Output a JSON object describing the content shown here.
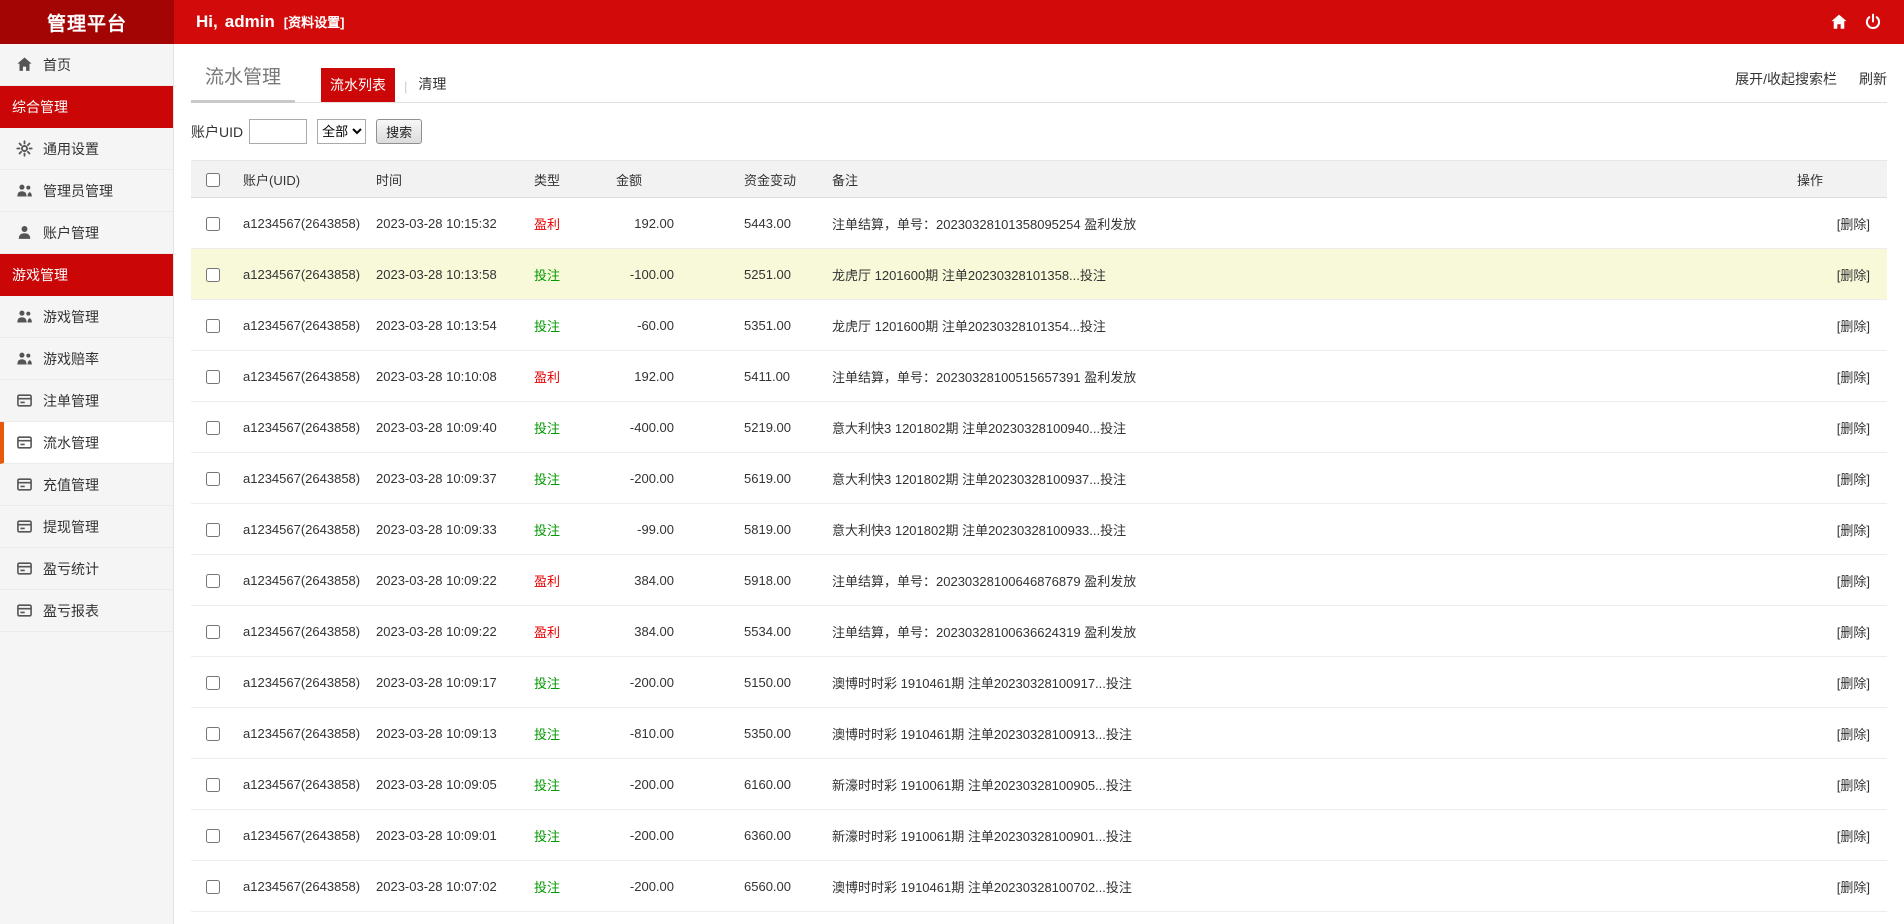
{
  "header": {
    "logo": "管理平台",
    "greeting_prefix": "Hi,",
    "username": "admin",
    "profile_link": "[资料设置]"
  },
  "sidebar": {
    "items": [
      {
        "key": "home",
        "type": "item",
        "label": "首页",
        "icon": "home-icon",
        "active": false
      },
      {
        "key": "section-general",
        "type": "section",
        "label": "综合管理"
      },
      {
        "key": "general-settings",
        "type": "item",
        "label": "通用设置",
        "icon": "gear-icon",
        "active": false
      },
      {
        "key": "admin-management",
        "type": "item",
        "label": "管理员管理",
        "icon": "admins-icon",
        "active": false
      },
      {
        "key": "account-management",
        "type": "item",
        "label": "账户管理",
        "icon": "user-icon",
        "active": false
      },
      {
        "key": "section-games",
        "type": "section",
        "label": "游戏管理"
      },
      {
        "key": "game-management",
        "type": "item",
        "label": "游戏管理",
        "icon": "games-icon",
        "active": false
      },
      {
        "key": "game-odds",
        "type": "item",
        "label": "游戏赔率",
        "icon": "odds-icon",
        "active": false
      },
      {
        "key": "bet-orders",
        "type": "item",
        "label": "注单管理",
        "icon": "orders-icon",
        "active": false
      },
      {
        "key": "flow-management",
        "type": "item",
        "label": "流水管理",
        "icon": "flow-icon",
        "active": true
      },
      {
        "key": "recharge-management",
        "type": "item",
        "label": "充值管理",
        "icon": "recharge-icon",
        "active": false
      },
      {
        "key": "withdraw-management",
        "type": "item",
        "label": "提现管理",
        "icon": "withdraw-icon",
        "active": false
      },
      {
        "key": "pnl-stats",
        "type": "item",
        "label": "盈亏统计",
        "icon": "stats-icon",
        "active": false
      },
      {
        "key": "pnl-report",
        "type": "item",
        "label": "盈亏报表",
        "icon": "report-icon",
        "active": false
      }
    ]
  },
  "page": {
    "title": "流水管理",
    "tabs": [
      {
        "label": "流水列表",
        "active": true
      },
      {
        "label": "清理",
        "active": false
      }
    ],
    "tabs_divider": "|",
    "toolbar": {
      "toggle_search": "展开/收起搜索栏",
      "refresh": "刷新"
    }
  },
  "search": {
    "uid_label": "账户UID",
    "uid_value": "",
    "type_selected": "全部",
    "search_button": "搜索"
  },
  "table": {
    "headers": [
      "账户(UID)",
      "时间",
      "类型",
      "金额",
      "资金变动",
      "备注",
      "操作"
    ],
    "delete_label": "[删除]",
    "rows": [
      {
        "uid": "a1234567(2643858)",
        "time": "2023-03-28 10:15:32",
        "type": "盈利",
        "amount": "192.00",
        "balance": "5443.00",
        "note": "注单结算，单号：20230328101358095254 盈利发放",
        "highlighted": false
      },
      {
        "uid": "a1234567(2643858)",
        "time": "2023-03-28 10:13:58",
        "type": "投注",
        "amount": "-100.00",
        "balance": "5251.00",
        "note": "龙虎厅 1201600期 注单20230328101358...投注",
        "highlighted": true
      },
      {
        "uid": "a1234567(2643858)",
        "time": "2023-03-28 10:13:54",
        "type": "投注",
        "amount": "-60.00",
        "balance": "5351.00",
        "note": "龙虎厅 1201600期 注单20230328101354...投注",
        "highlighted": false
      },
      {
        "uid": "a1234567(2643858)",
        "time": "2023-03-28 10:10:08",
        "type": "盈利",
        "amount": "192.00",
        "balance": "5411.00",
        "note": "注单结算，单号：20230328100515657391 盈利发放",
        "highlighted": false
      },
      {
        "uid": "a1234567(2643858)",
        "time": "2023-03-28 10:09:40",
        "type": "投注",
        "amount": "-400.00",
        "balance": "5219.00",
        "note": "意大利快3 1201802期 注单20230328100940...投注",
        "highlighted": false
      },
      {
        "uid": "a1234567(2643858)",
        "time": "2023-03-28 10:09:37",
        "type": "投注",
        "amount": "-200.00",
        "balance": "5619.00",
        "note": "意大利快3 1201802期 注单20230328100937...投注",
        "highlighted": false
      },
      {
        "uid": "a1234567(2643858)",
        "time": "2023-03-28 10:09:33",
        "type": "投注",
        "amount": "-99.00",
        "balance": "5819.00",
        "note": "意大利快3 1201802期 注单20230328100933...投注",
        "highlighted": false
      },
      {
        "uid": "a1234567(2643858)",
        "time": "2023-03-28 10:09:22",
        "type": "盈利",
        "amount": "384.00",
        "balance": "5918.00",
        "note": "注单结算，单号：20230328100646876879 盈利发放",
        "highlighted": false
      },
      {
        "uid": "a1234567(2643858)",
        "time": "2023-03-28 10:09:22",
        "type": "盈利",
        "amount": "384.00",
        "balance": "5534.00",
        "note": "注单结算，单号：20230328100636624319 盈利发放",
        "highlighted": false
      },
      {
        "uid": "a1234567(2643858)",
        "time": "2023-03-28 10:09:17",
        "type": "投注",
        "amount": "-200.00",
        "balance": "5150.00",
        "note": "澳博时时彩 1910461期 注单20230328100917...投注",
        "highlighted": false
      },
      {
        "uid": "a1234567(2643858)",
        "time": "2023-03-28 10:09:13",
        "type": "投注",
        "amount": "-810.00",
        "balance": "5350.00",
        "note": "澳博时时彩 1910461期 注单20230328100913...投注",
        "highlighted": false
      },
      {
        "uid": "a1234567(2643858)",
        "time": "2023-03-28 10:09:05",
        "type": "投注",
        "amount": "-200.00",
        "balance": "6160.00",
        "note": "新濠时时彩 1910061期 注单20230328100905...投注",
        "highlighted": false
      },
      {
        "uid": "a1234567(2643858)",
        "time": "2023-03-28 10:09:01",
        "type": "投注",
        "amount": "-200.00",
        "balance": "6360.00",
        "note": "新濠时时彩 1910061期 注单20230328100901...投注",
        "highlighted": false
      },
      {
        "uid": "a1234567(2643858)",
        "time": "2023-03-28 10:07:02",
        "type": "投注",
        "amount": "-200.00",
        "balance": "6560.00",
        "note": "澳博时时彩 1910461期 注单20230328100702...投注",
        "highlighted": false
      }
    ]
  },
  "colors": {
    "header_red": "#d30a0a",
    "logo_red": "#a30505",
    "section_red": "#ca0606",
    "active_tab_red": "#cb0707",
    "active_item_bar": "#e8590c",
    "profit_red": "#e60000",
    "bet_green": "#009900",
    "highlight_row": "#f8f9d9"
  }
}
